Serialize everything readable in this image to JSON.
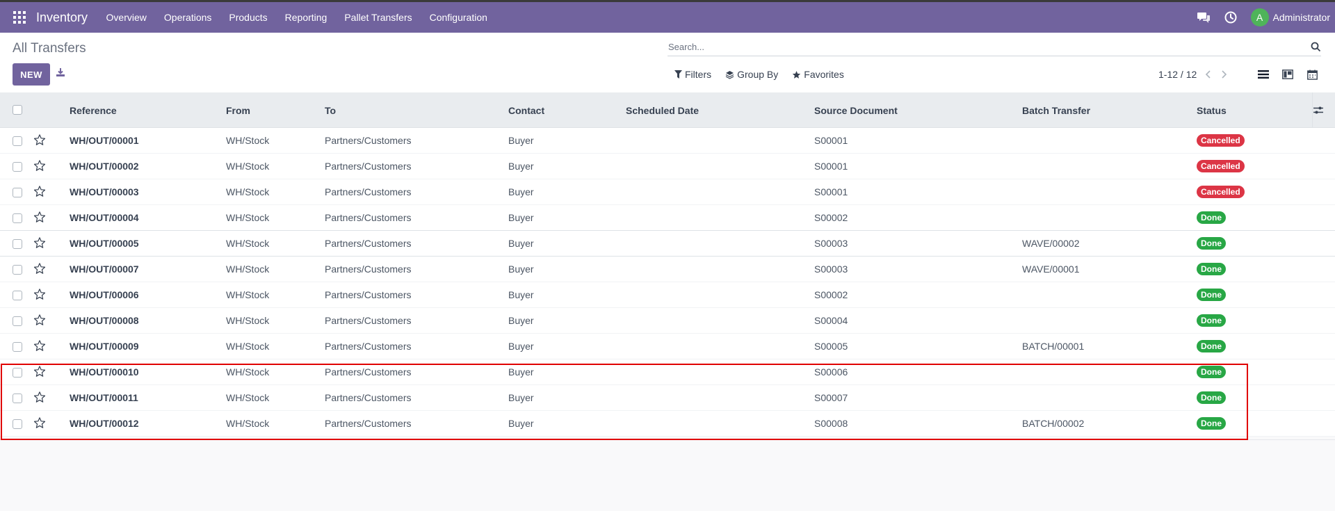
{
  "navbar": {
    "app_name": "Inventory",
    "menu": [
      "Overview",
      "Operations",
      "Products",
      "Reporting",
      "Pallet Transfers",
      "Configuration"
    ],
    "user_initial": "A",
    "user_name": "Administrator",
    "icons": [
      "apps-grid-icon",
      "chat-icon",
      "clock-icon"
    ]
  },
  "control_panel": {
    "title": "All Transfers",
    "new_label": "NEW",
    "search_placeholder": "Search...",
    "filters_label": "Filters",
    "group_by_label": "Group By",
    "favorites_label": "Favorites",
    "pager": "1-12 / 12"
  },
  "table": {
    "columns": [
      "Reference",
      "From",
      "To",
      "Contact",
      "Scheduled Date",
      "Source Document",
      "Batch Transfer",
      "Status"
    ],
    "rows": [
      {
        "reference": "WH/OUT/00001",
        "from": "WH/Stock",
        "to": "Partners/Customers",
        "contact": "Buyer",
        "scheduled": "",
        "source": "S00001",
        "batch": "",
        "status": "Cancelled"
      },
      {
        "reference": "WH/OUT/00002",
        "from": "WH/Stock",
        "to": "Partners/Customers",
        "contact": "Buyer",
        "scheduled": "",
        "source": "S00001",
        "batch": "",
        "status": "Cancelled"
      },
      {
        "reference": "WH/OUT/00003",
        "from": "WH/Stock",
        "to": "Partners/Customers",
        "contact": "Buyer",
        "scheduled": "",
        "source": "S00001",
        "batch": "",
        "status": "Cancelled"
      },
      {
        "reference": "WH/OUT/00004",
        "from": "WH/Stock",
        "to": "Partners/Customers",
        "contact": "Buyer",
        "scheduled": "",
        "source": "S00002",
        "batch": "",
        "status": "Done"
      },
      {
        "reference": "WH/OUT/00005",
        "from": "WH/Stock",
        "to": "Partners/Customers",
        "contact": "Buyer",
        "scheduled": "",
        "source": "S00003",
        "batch": "WAVE/00002",
        "status": "Done"
      },
      {
        "reference": "WH/OUT/00007",
        "from": "WH/Stock",
        "to": "Partners/Customers",
        "contact": "Buyer",
        "scheduled": "",
        "source": "S00003",
        "batch": "WAVE/00001",
        "status": "Done"
      },
      {
        "reference": "WH/OUT/00006",
        "from": "WH/Stock",
        "to": "Partners/Customers",
        "contact": "Buyer",
        "scheduled": "",
        "source": "S00002",
        "batch": "",
        "status": "Done"
      },
      {
        "reference": "WH/OUT/00008",
        "from": "WH/Stock",
        "to": "Partners/Customers",
        "contact": "Buyer",
        "scheduled": "",
        "source": "S00004",
        "batch": "",
        "status": "Done"
      },
      {
        "reference": "WH/OUT/00009",
        "from": "WH/Stock",
        "to": "Partners/Customers",
        "contact": "Buyer",
        "scheduled": "",
        "source": "S00005",
        "batch": "BATCH/00001",
        "status": "Done"
      },
      {
        "reference": "WH/OUT/00010",
        "from": "WH/Stock",
        "to": "Partners/Customers",
        "contact": "Buyer",
        "scheduled": "",
        "source": "S00006",
        "batch": "",
        "status": "Done"
      },
      {
        "reference": "WH/OUT/00011",
        "from": "WH/Stock",
        "to": "Partners/Customers",
        "contact": "Buyer",
        "scheduled": "",
        "source": "S00007",
        "batch": "",
        "status": "Done"
      },
      {
        "reference": "WH/OUT/00012",
        "from": "WH/Stock",
        "to": "Partners/Customers",
        "contact": "Buyer",
        "scheduled": "",
        "source": "S00008",
        "batch": "BATCH/00002",
        "status": "Done"
      }
    ]
  },
  "colors": {
    "brand": "#71639e",
    "cancelled": "#dc3545",
    "done": "#28a745",
    "highlight": "#e00000"
  }
}
